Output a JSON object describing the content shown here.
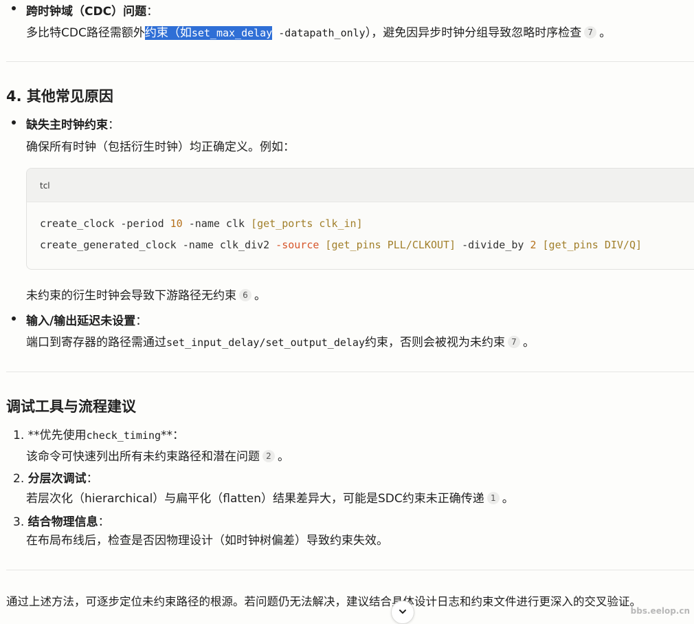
{
  "sec_cdc": {
    "title": "跨时钟域（CDC）问题",
    "colon": "：",
    "desc_pre": "多比特CDC路径需额外",
    "desc_sel": "约束（如",
    "desc_sel_code": "set_max_delay",
    "desc_code_rest": " -datapath_only",
    "desc_post": "），避免因异步时钟分组导致忽略时序检查",
    "cite": "7",
    "end": "。"
  },
  "section4": {
    "heading": "4. 其他常见原因",
    "item1": {
      "title": "缺失主时钟约束",
      "colon": "：",
      "desc": "确保所有时钟（包括衍生时钟）均正确定义。例如："
    },
    "code": {
      "lang": "tcl",
      "line1": {
        "a": "create_clock -period ",
        "b": "10",
        "c": " -name clk ",
        "d": "[get_ports clk_in]"
      },
      "line2": {
        "a": "create_generated_clock -name clk_div2 ",
        "b": "-source",
        "c": " ",
        "d": "[get_pins PLL/CLKOUT]",
        "e": " -divide_by ",
        "f": "2",
        "g": " ",
        "h": "[get_pins DIV/Q]"
      }
    },
    "after_code": {
      "text": "未约束的衍生时钟会导致下游路径无约束",
      "cite": "6",
      "end": "。"
    },
    "item2": {
      "title": "输入/输出延迟未设置",
      "colon": "：",
      "desc_pre": "端口到寄存器的路径需通过",
      "desc_code": "set_input_delay/set_output_delay",
      "desc_post": "约束，否则会被视为未约束",
      "cite": "7",
      "end": "。"
    }
  },
  "section_tools": {
    "heading": "调试工具与流程建议",
    "items": [
      {
        "num": "1.",
        "title_pre": "**优先使用",
        "title_code": "check_timing",
        "title_post": "**",
        "colon": "：",
        "desc": "该命令可快速列出所有未约束路径和潜在问题",
        "cite": "2",
        "end": "。"
      },
      {
        "num": "2.",
        "title": "分层次调试",
        "colon": "：",
        "desc": "若层次化（hierarchical）与扁平化（flatten）结果差异大，可能是SDC约束未正确传递",
        "cite": "1",
        "end": "。"
      },
      {
        "num": "3.",
        "title": "结合物理信息",
        "colon": "：",
        "desc": "在布局布线后，检查是否因物理设计（如时钟树偏差）导致约束失效。"
      }
    ]
  },
  "conclusion": "通过上述方法，可逐步定位未约束路径的根源。若问题仍无法解决，建议结合具体设计日志和约束文件进行更深入的交叉验证。",
  "watermark": "bbs.eelop.cn",
  "colors": {
    "selection": "#2f6fd6",
    "number": "#b5711c",
    "bracket": "#a17f2a",
    "keyword": "#d7562b"
  },
  "icons": {
    "scroll": "chevron-down-icon"
  }
}
